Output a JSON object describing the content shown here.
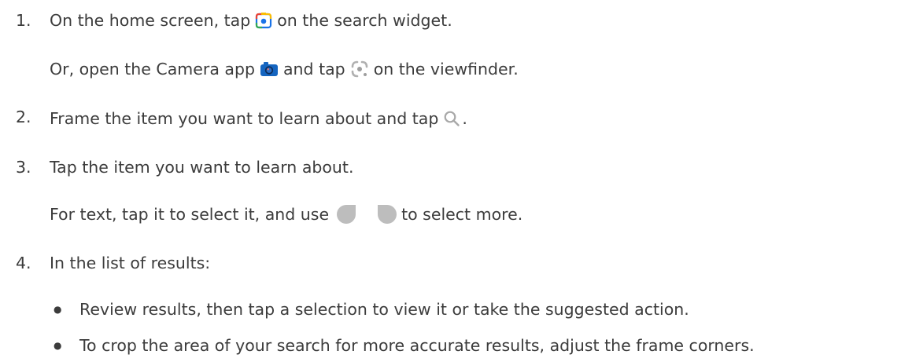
{
  "steps": [
    {
      "num": "1.",
      "text_before_icon": "On the home screen, tap",
      "icon": "google-lens-icon",
      "text_after_icon": "on the search widget."
    },
    {
      "alt_text_before_camera": "Or, open the Camera app",
      "camera_icon": "camera-app-icon",
      "alt_text_middle": "and tap",
      "viewfinder_icon": "lens-viewfinder-icon",
      "alt_text_after": "on the viewfinder."
    },
    {
      "num": "2.",
      "text_before_icon": "Frame the item you want to learn about and tap",
      "icon": "search-icon",
      "text_after_icon": "."
    },
    {
      "num": "3.",
      "text": "Tap the item you want to learn about.",
      "sub_before": "For text, tap it to select it, and use",
      "handles_icon": "selection-handles-icon",
      "sub_after": "to select more."
    },
    {
      "num": "4.",
      "text": "In the list of results:",
      "bullets": [
        "Review results, then tap a selection to view it or take the suggested action.",
        "To crop the area of your search for more accurate results, adjust the frame corners."
      ]
    }
  ],
  "colors": {
    "text": "#3c3c3c",
    "lens_blue": "#1a73e8",
    "lens_red": "#ea4335",
    "lens_yellow": "#fbbc04",
    "lens_green": "#34a853",
    "camera_blue": "#1565c0",
    "handle_gray": "#bdbdbd",
    "search_gray": "#9e9e9e"
  }
}
